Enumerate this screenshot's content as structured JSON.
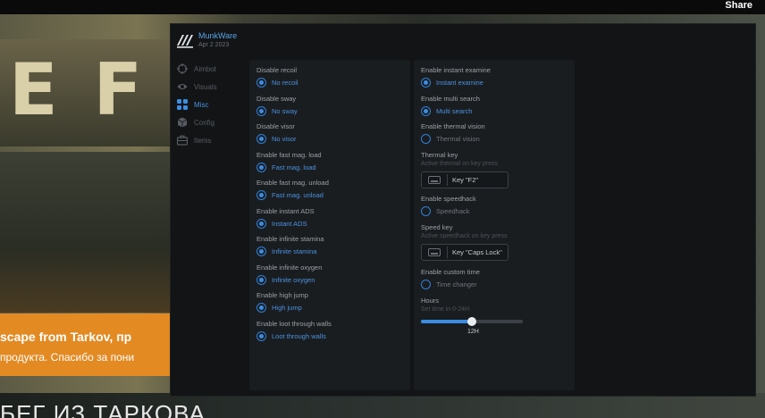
{
  "video": {
    "share_label": "Share",
    "banner_line1": "scape from Tarkov, пр",
    "banner_line2": "продукта. Спасибо за пони",
    "title_fragment": "E F",
    "bottom_text": "БЕГ ИЗ ТАРКОВА"
  },
  "menu": {
    "brand": "MunkWare",
    "date": "Apr 2 2023",
    "sidebar": [
      {
        "label": "Aimbot",
        "icon": "crosshair-icon",
        "active": false
      },
      {
        "label": "Visuals",
        "icon": "eye-icon",
        "active": false
      },
      {
        "label": "Misc",
        "icon": "grid-icon",
        "active": true
      },
      {
        "label": "Config",
        "icon": "cube-icon",
        "active": false
      },
      {
        "label": "Items",
        "icon": "briefcase-icon",
        "active": false
      }
    ],
    "left": {
      "g0": {
        "title": "Disable recoil",
        "check": "No recoil",
        "checked": true
      },
      "g1": {
        "title": "Disable sway",
        "check": "No sway",
        "checked": true
      },
      "g2": {
        "title": "Disable visor",
        "check": "No visor",
        "checked": true
      },
      "g3": {
        "title": "Enable fast mag. load",
        "check": "Fast mag. load",
        "checked": true
      },
      "g4": {
        "title": "Enable fast mag. unload",
        "check": "Fast mag. unload",
        "checked": true
      },
      "g5": {
        "title": "Enable instant ADS",
        "check": "Instant ADS",
        "checked": true
      },
      "g6": {
        "title": "Enable infinite stamina",
        "check": "Infinite stamina",
        "checked": true
      },
      "g7": {
        "title": "Enable infinite oxygen",
        "check": "Infinite oxygen",
        "checked": true
      },
      "g8": {
        "title": "Enable high jump",
        "check": "High jump",
        "checked": true
      },
      "g9": {
        "title": "Enable loot through walls",
        "check": "Loot through walls",
        "checked": true
      }
    },
    "right": {
      "instant_examine": {
        "title": "Enable instant examine",
        "check": "Instant examine",
        "checked": true
      },
      "multi_search": {
        "title": "Enable multi search",
        "check": "Multi search",
        "checked": true
      },
      "thermal_vision": {
        "title": "Enable thermal vision",
        "check": "Thermal vision",
        "checked": false
      },
      "thermal_key": {
        "title": "Thermal key",
        "desc": "Active thermal on key press",
        "key": "Key \"F2\""
      },
      "speedhack": {
        "title": "Enable speedhack",
        "check": "Speedhack",
        "checked": false
      },
      "speed_key": {
        "title": "Speed key",
        "desc": "Active speedhack on key press",
        "key": "Key \"Caps Lock\""
      },
      "custom_time": {
        "title": "Enable custom time",
        "check": "Time changer",
        "checked": false
      },
      "hours": {
        "title": "Hours",
        "desc": "Set time in 0-24H",
        "value": 12,
        "min": 0,
        "max": 24,
        "value_label": "12H"
      }
    },
    "colors": {
      "accent": "#3a8de4",
      "panel": "#1a1d20",
      "window": "#121416"
    }
  }
}
